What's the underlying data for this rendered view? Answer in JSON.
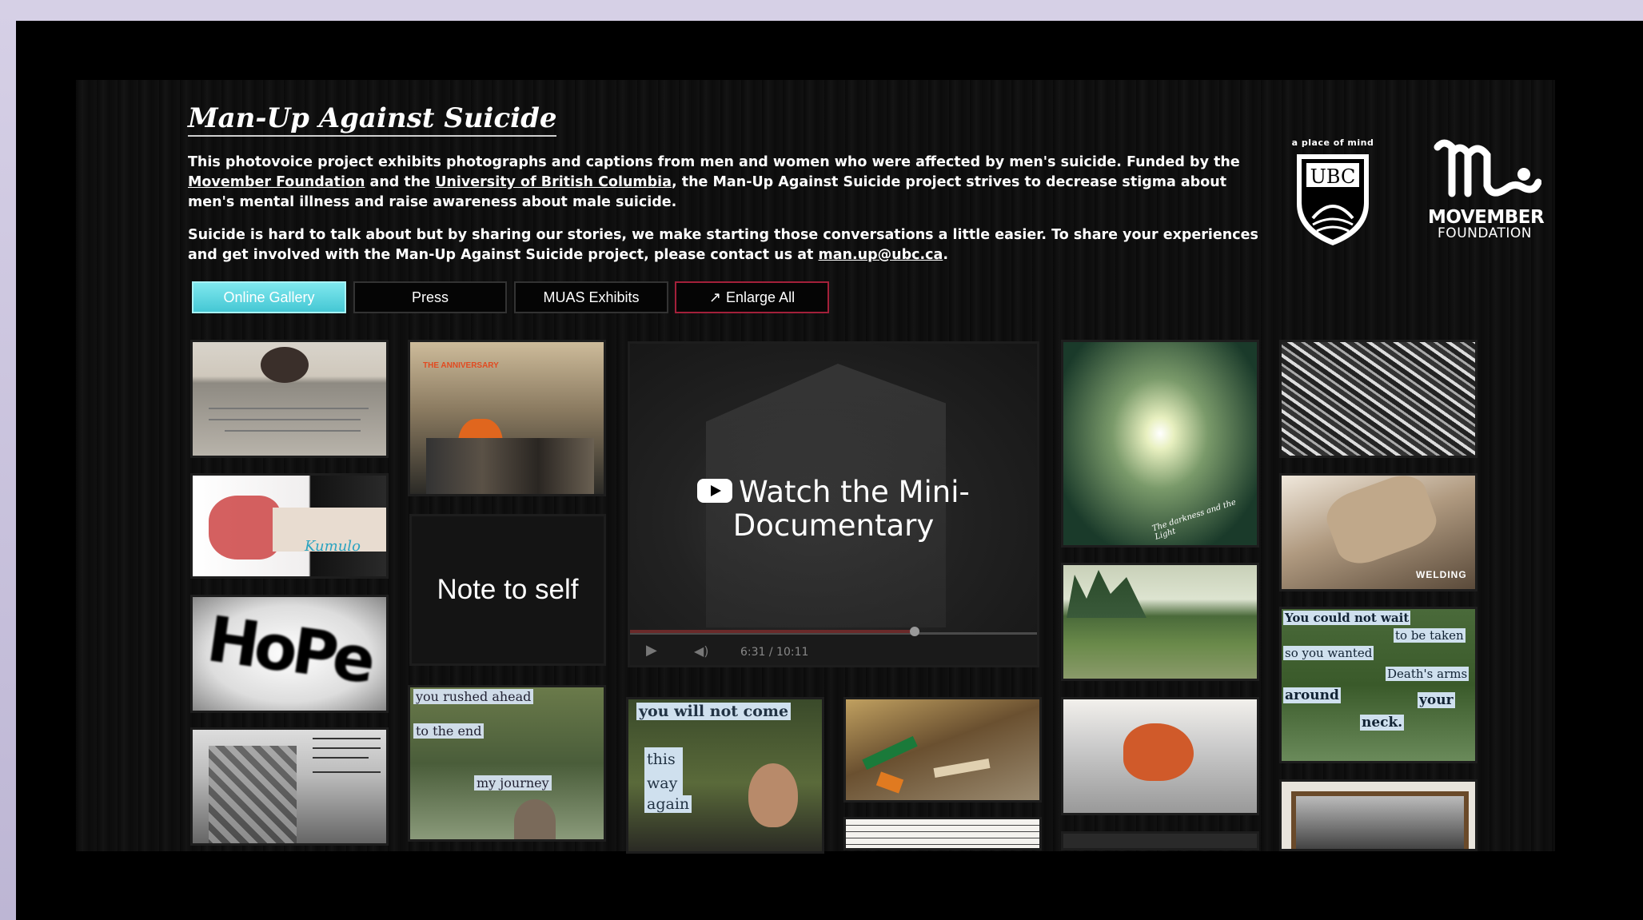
{
  "page": {
    "title": "Man-Up Against Suicide",
    "intro": {
      "part1": "This photovoice project exhibits photographs and captions from men and women who were affected by men's suicide. Funded by the ",
      "link1": "Movember Foundation",
      "part2": " and the ",
      "link2": "University of British Columbia",
      "part3": ", the Man-Up Against Suicide project strives to decrease stigma about men's mental illness and raise awareness about male suicide."
    },
    "intro2": {
      "part1": "Suicide is hard to talk about but by sharing our stories, we make starting those conversations a little easier. To share your experiences and get involved with the Man-Up Against Suicide project, please contact us at ",
      "email": "man.up@ubc.ca",
      "part2": "."
    }
  },
  "logos": {
    "ubc_tagline": "a place of mind",
    "ubc_text": "UBC",
    "movember_text": "MOVEMBER",
    "movember_sub": "FOUNDATION"
  },
  "nav": {
    "gallery": "Online Gallery",
    "press": "Press",
    "exhibits": "MUAS Exhibits",
    "enlarge": "Enlarge All",
    "enlarge_icon": "↗"
  },
  "tiles": {
    "note": "Note to self",
    "video_title": "Watch the Mini-Documentary",
    "video_title_line1": "Watch the Mini-",
    "video_title_line2": "Documentary",
    "video_time": "6:31 / 10:11",
    "hope": "HoPe",
    "wrist_text": "Kumulo",
    "anniversary": "THE ANNIVERSARY",
    "darkness": "The darkness and the Light",
    "welding": "WELDING",
    "collage_right": [
      "You could not wait",
      "to be taken",
      "so you wanted",
      "Death's arms",
      "around",
      "your",
      "neck."
    ],
    "collage_mid1": [
      "you rushed ahead",
      "to the end",
      "my journey"
    ],
    "collage_mid2": [
      "you will not come",
      "this way",
      "again"
    ]
  },
  "colors": {
    "accent": "#45c7d4",
    "enlarge_border": "#a3203a"
  }
}
